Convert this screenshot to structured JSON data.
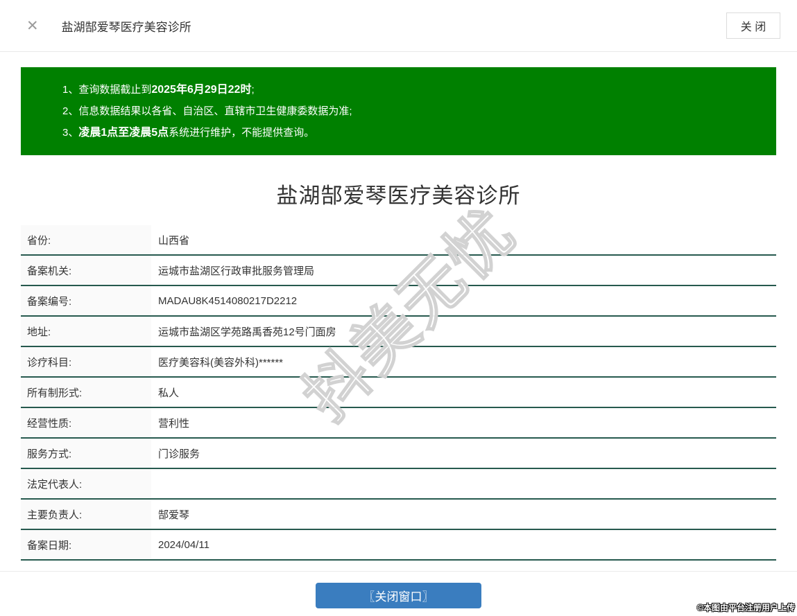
{
  "header": {
    "close_icon": "✕",
    "title": "盐湖郜爱琴医疗美容诊所",
    "close_button_label": "关 闭"
  },
  "notice": {
    "lines": [
      {
        "num": "1、",
        "pre": "查询数据截止到",
        "bold": "2025年6月29日22时",
        "post": ";"
      },
      {
        "num": "2、",
        "pre": "信息数据结果以各省、自治区、直辖市卫生健康委数据为准;",
        "bold": "",
        "post": ""
      },
      {
        "num": "3、",
        "pre": "",
        "bold": "凌晨1点至凌晨5点",
        "post": "系统进行维护，不能提供查询。"
      }
    ]
  },
  "detail": {
    "title": "盐湖郜爱琴医疗美容诊所",
    "rows": [
      {
        "label": "省份:",
        "value": "山西省"
      },
      {
        "label": "备案机关:",
        "value": "运城市盐湖区行政审批服务管理局"
      },
      {
        "label": "备案编号:",
        "value": "MADAU8K4514080217D2212"
      },
      {
        "label": "地址:",
        "value": "运城市盐湖区学苑路禹香苑12号门面房"
      },
      {
        "label": "诊疗科目:",
        "value": "医疗美容科(美容外科)******"
      },
      {
        "label": "所有制形式:",
        "value": "私人"
      },
      {
        "label": "经营性质:",
        "value": "营利性"
      },
      {
        "label": "服务方式:",
        "value": "门诊服务"
      },
      {
        "label": "法定代表人:",
        "value": ""
      },
      {
        "label": "主要负责人:",
        "value": "郜爱琴"
      },
      {
        "label": "备案日期:",
        "value": "2024/04/11"
      }
    ]
  },
  "footer": {
    "close_window_button": "〖关闭窗口〗",
    "copyright": "©本图由平台注册用户上传"
  },
  "watermark": "抖美无忧",
  "colors": {
    "notice_bg": "#008000",
    "row_divider": "#26594e",
    "primary_button": "#3a7dbf"
  }
}
